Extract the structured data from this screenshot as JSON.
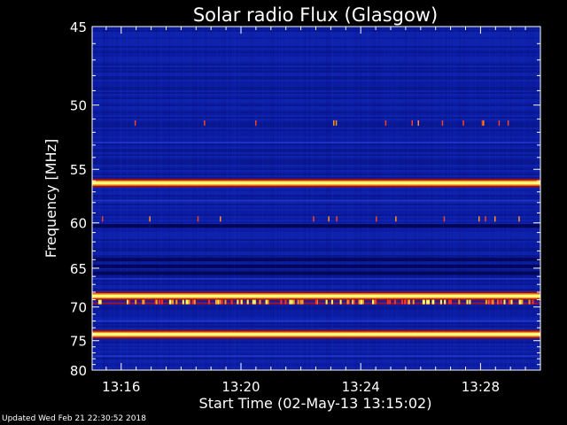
{
  "chart_data": {
    "type": "heatmap",
    "title": "Solar radio Flux (Glasgow)",
    "xlabel": "Start Time (02-May-13 13:15:02)",
    "ylabel": "Frequency [MHz]",
    "x_tick_labels": [
      "13:16",
      "13:20",
      "13:24",
      "13:28"
    ],
    "x_ticks_minutes_after_13_00": [
      16,
      20,
      24,
      28
    ],
    "xlim_minutes_after_13_00": [
      15.03,
      30.0
    ],
    "y_tick_labels": [
      "45",
      "50",
      "55",
      "60",
      "65",
      "70",
      "75",
      "80"
    ],
    "y_ticks_mhz": [
      45,
      50,
      55,
      60,
      65,
      70,
      75,
      80
    ],
    "ylim_mhz": [
      45,
      80
    ],
    "y_scale": "reciprocal",
    "y_direction": "increasing-downward",
    "colormap": {
      "background": "#0a1a9a",
      "low": "#000040",
      "high": "#ffff80"
    },
    "bright_bands_mhz": [
      56.2,
      68.5,
      74.0
    ],
    "dark_bands_mhz": [
      60.3,
      64.0,
      64.8,
      65.6
    ],
    "interference_row_mhz": 69.5,
    "burst_rows_mhz": [
      51.3,
      59.6
    ],
    "footer": "Updated Wed Feb 21 22:30:52 2018"
  }
}
